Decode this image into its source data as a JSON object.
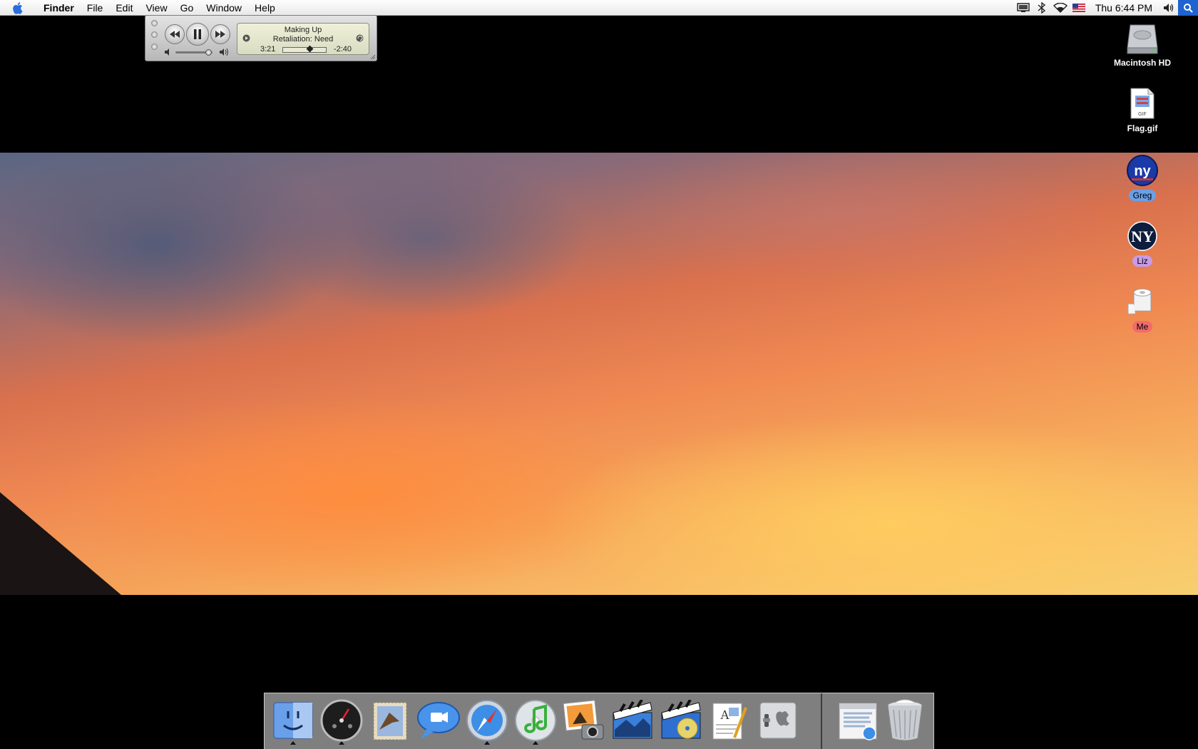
{
  "menubar": {
    "apple_icon": "apple-logo-icon",
    "app_name": "Finder",
    "menus": [
      "File",
      "Edit",
      "View",
      "Go",
      "Window",
      "Help"
    ],
    "status_icons": [
      "display-icon",
      "bluetooth-icon",
      "airport-wifi-icon",
      "us-flag-input-icon"
    ],
    "clock": "Thu 6:44 PM",
    "volume_icon": "volume-icon",
    "spotlight_icon": "spotlight-search-icon"
  },
  "itunes_mini": {
    "song_title": "Making Up",
    "artist": "Retaliation: Need",
    "elapsed": "3:21",
    "remaining": "-2:40",
    "progress": 0.56,
    "volume_level": 0.9
  },
  "desktop_icons": [
    {
      "label": "Macintosh HD",
      "icon": "hard-drive-icon"
    },
    {
      "label": "Flag.gif",
      "icon": "gif-file-icon"
    },
    {
      "label": "Greg",
      "icon": "ny-giants-logo-icon",
      "label_color": "#6aa0e6"
    },
    {
      "label": "Liz",
      "icon": "ny-yankees-logo-icon",
      "label_color": "#c79be6"
    },
    {
      "label": "Me",
      "icon": "toilet-paper-icon",
      "label_color": "#f26b6b"
    }
  ],
  "dock": {
    "apps": [
      {
        "name": "Finder",
        "icon": "finder-icon",
        "running": true
      },
      {
        "name": "Dashboard",
        "icon": "dashboard-icon",
        "running": true
      },
      {
        "name": "Mail",
        "icon": "mail-icon",
        "running": false
      },
      {
        "name": "iChat",
        "icon": "ichat-icon",
        "running": false
      },
      {
        "name": "Safari",
        "icon": "safari-icon",
        "running": true
      },
      {
        "name": "iTunes",
        "icon": "itunes-icon",
        "running": true
      },
      {
        "name": "iPhoto",
        "icon": "iphoto-icon",
        "running": false
      },
      {
        "name": "iMovie",
        "icon": "imovie-icon",
        "running": false
      },
      {
        "name": "iDVD",
        "icon": "idvd-icon",
        "running": false
      },
      {
        "name": "TextEdit",
        "icon": "textedit-icon",
        "running": false
      },
      {
        "name": "System Preferences",
        "icon": "system-preferences-icon",
        "running": false
      }
    ],
    "minimized": {
      "icon": "minimized-safari-window-icon"
    },
    "trash": {
      "icon": "trash-icon"
    }
  }
}
